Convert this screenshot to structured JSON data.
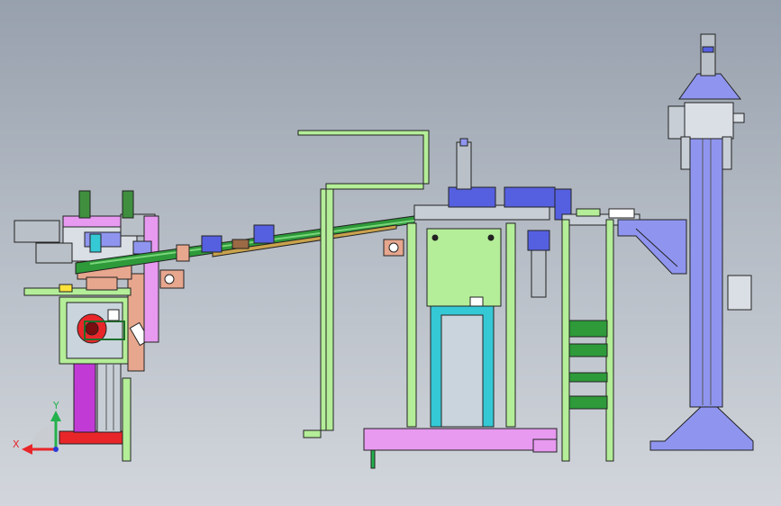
{
  "triad": {
    "x_label": "X",
    "y_label": "Y"
  },
  "colors": {
    "frame_green": "#b4ee98",
    "frame_dark_green": "#3f8f3f",
    "conveyor_green": "#2e9a3a",
    "column_blue": "#8f95ef",
    "slide_blue": "#5560e0",
    "base_pink": "#e79af0",
    "magenta": "#c13ad6",
    "cyan": "#35c9d6",
    "red": "#e8262a",
    "salmon": "#e7a78e",
    "brown": "#9b6a45",
    "axis_red": "#e8262a",
    "axis_green": "#22b14c",
    "axis_blue": "#2a3bd6"
  }
}
